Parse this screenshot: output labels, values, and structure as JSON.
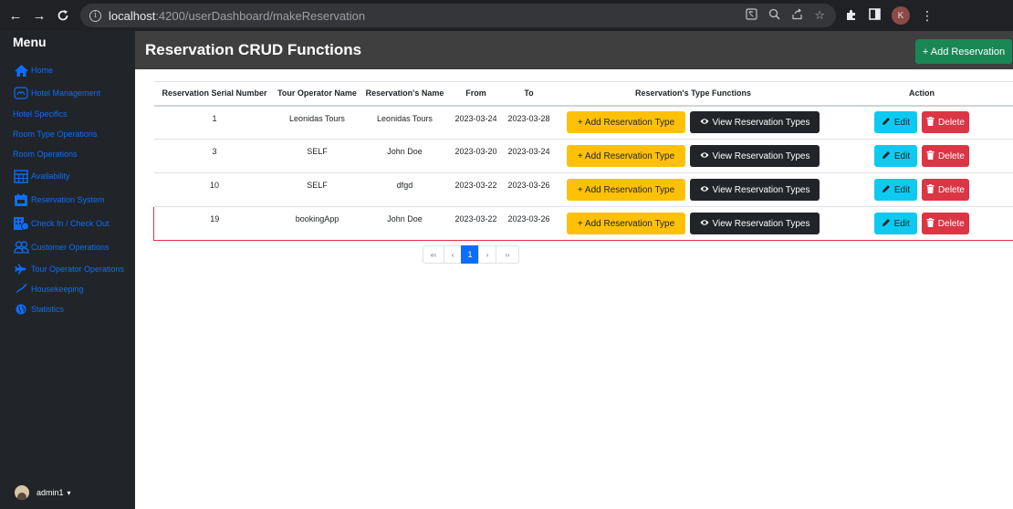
{
  "browser": {
    "url_host": "localhost",
    "url_path": ":4200/userDashboard/makeReservation",
    "profile_initial": "K"
  },
  "sidebar": {
    "title": "Menu",
    "items": [
      {
        "label": "Home",
        "icon": "home-icon"
      },
      {
        "label": "Hotel Management",
        "icon": "hotel-management-icon"
      },
      {
        "label": "Hotel Specifics",
        "icon": ""
      },
      {
        "label": "Room Type Operations",
        "icon": ""
      },
      {
        "label": "Room Operations",
        "icon": ""
      },
      {
        "label": "Availability",
        "icon": "calendar-grid-icon"
      },
      {
        "label": "Reservation System",
        "icon": "reservation-icon"
      },
      {
        "label": "Check In / Check Out",
        "icon": "check-in-out-icon"
      },
      {
        "label": "Customer Operations",
        "icon": "users-icon"
      },
      {
        "label": "Tour Operator Operations",
        "icon": "plane-icon"
      },
      {
        "label": "Housekeeping",
        "icon": "broom-icon"
      },
      {
        "label": "Statistics",
        "icon": "globe-icon"
      }
    ],
    "user": "admin1",
    "user_caret": "▾"
  },
  "header": {
    "title": "Reservation CRUD Functions",
    "add_button": "+ Add Reservation"
  },
  "table": {
    "columns": [
      "Reservation Serial Number",
      "Tour Operator Name",
      "Reservation's Name",
      "From",
      "To",
      "Reservation's Type Functions",
      "Action"
    ],
    "rows": [
      {
        "serial": "1",
        "operator": "Leonidas Tours",
        "name": "Leonidas Tours",
        "from": "2023-03-24",
        "to": "2023-03-28"
      },
      {
        "serial": "3",
        "operator": "SELF",
        "name": "John Doe",
        "from": "2023-03-20",
        "to": "2023-03-24"
      },
      {
        "serial": "10",
        "operator": "SELF",
        "name": "dfgd",
        "from": "2023-03-22",
        "to": "2023-03-26"
      },
      {
        "serial": "19",
        "operator": "bookingApp",
        "name": "John Doe",
        "from": "2023-03-22",
        "to": "2023-03-26"
      }
    ],
    "add_type_label": "+ Add Reservation Type",
    "view_types_label": "View Reservation Types",
    "edit_label": "Edit",
    "delete_label": "Delete",
    "highlighted_row_index": 3
  },
  "pagination": {
    "first": "«‹",
    "prev": "‹",
    "current": "1",
    "next": "›",
    "last": "››"
  },
  "colors": {
    "sidebar_bg": "#212529",
    "sidebar_link": "#0d6efd",
    "header_bg": "#3f3f3f",
    "success": "#198754",
    "warning": "#ffc107",
    "dark": "#212529",
    "info": "#0dcaf0",
    "danger": "#dc3545",
    "highlight_border": "#dc3545"
  }
}
